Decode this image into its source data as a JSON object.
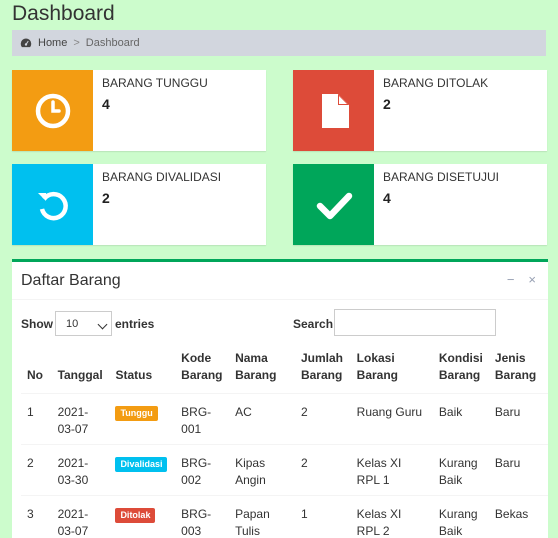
{
  "page": {
    "title": "Dashboard"
  },
  "breadcrumb": {
    "home": "Home",
    "separator": ">",
    "current": "Dashboard"
  },
  "boxes": [
    {
      "label": "BARANG TUNGGU",
      "count": "4",
      "color": "#f39c12",
      "icon": "clock-icon"
    },
    {
      "label": "BARANG DITOLAK",
      "count": "2",
      "color": "#dd4b39",
      "icon": "file-icon"
    },
    {
      "label": "BARANG DIVALIDASI",
      "count": "2",
      "color": "#00c0ef",
      "icon": "refresh-icon"
    },
    {
      "label": "BARANG DISETUJUI",
      "count": "4",
      "color": "#00a65a",
      "icon": "check-icon"
    }
  ],
  "panel": {
    "title": "Daftar Barang",
    "collapse_glyph": "−",
    "close_glyph": "×",
    "show_label": "Show",
    "page_length": "10",
    "entries_label": "entries",
    "search_label": "Search:",
    "search_value": ""
  },
  "table": {
    "headers": [
      "No",
      "Tanggal",
      "Status",
      "Kode Barang",
      "Nama Barang",
      "Jumlah Barang",
      "Lokasi Barang",
      "Kondisi Barang",
      "Jenis Barang"
    ],
    "rows": [
      {
        "no": "1",
        "tanggal": "2021-03-07",
        "status": "Tunggu",
        "status_color": "#f39c12",
        "kode": "BRG-001",
        "nama": "AC",
        "jumlah": "2",
        "lokasi": "Ruang Guru",
        "kondisi": "Baik",
        "jenis": "Baru"
      },
      {
        "no": "2",
        "tanggal": "2021-03-30",
        "status": "Divalidasi",
        "status_color": "#00c0ef",
        "kode": "BRG-002",
        "nama": "Kipas Angin",
        "jumlah": "2",
        "lokasi": "Kelas XI RPL 1",
        "kondisi": "Kurang Baik",
        "jenis": "Baru"
      },
      {
        "no": "3",
        "tanggal": "2021-03-07",
        "status": "Ditolak",
        "status_color": "#dd4b39",
        "kode": "BRG-003",
        "nama": "Papan Tulis",
        "jumlah": "1",
        "lokasi": "Kelas XI RPL 2",
        "kondisi": "Kurang Baik",
        "jenis": "Bekas"
      }
    ]
  }
}
